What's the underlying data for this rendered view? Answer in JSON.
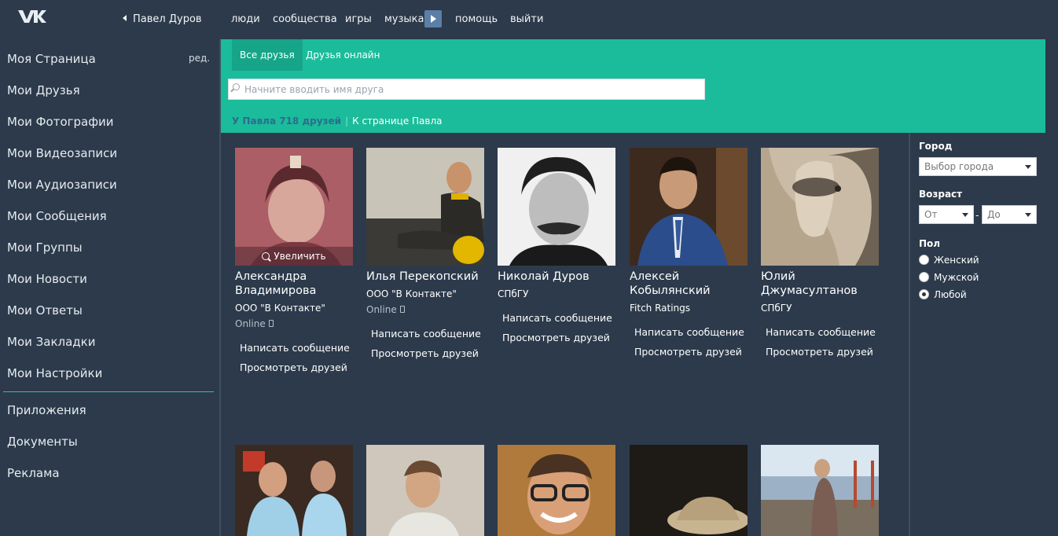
{
  "topbar": {
    "logo": "vk-logo",
    "back_user": "Павел Дуров",
    "nav": [
      "люди",
      "сообщества",
      "игры",
      "музыка",
      "помощь",
      "выйти"
    ]
  },
  "sidebar": {
    "items": [
      {
        "label": "Моя Страница"
      },
      {
        "label": "Мои Друзья"
      },
      {
        "label": "Мои Фотографии"
      },
      {
        "label": "Мои Видеозаписи"
      },
      {
        "label": "Мои Аудиозаписи"
      },
      {
        "label": "Мои Сообщения"
      },
      {
        "label": "Мои Группы"
      },
      {
        "label": "Мои Новости"
      },
      {
        "label": "Мои Ответы"
      },
      {
        "label": "Мои Закладки"
      },
      {
        "label": "Мои Настройки"
      }
    ],
    "edit_label": "ред.",
    "extra": [
      {
        "label": "Приложения"
      },
      {
        "label": "Документы"
      },
      {
        "label": "Реклама"
      }
    ]
  },
  "main": {
    "tabs": [
      {
        "label": "Все друзья",
        "active": true
      },
      {
        "label": "Друзья онлайн",
        "active": false
      }
    ],
    "search_placeholder": "Начните вводить имя друга",
    "friends_count": "У Павла 718 друзей",
    "to_page_link": "К странице Павла"
  },
  "filters": {
    "city_label": "Город",
    "city_select": "Выбор города",
    "age_label": "Возраст",
    "age_from": "От",
    "age_to": "До",
    "age_dash": "-",
    "gender_label": "Пол",
    "gender_options": [
      {
        "label": "Женский",
        "checked": false
      },
      {
        "label": "Мужской",
        "checked": false
      },
      {
        "label": "Любой",
        "checked": true
      }
    ]
  },
  "friends": [
    {
      "name": "Александра Владимирова",
      "work": "ООО \"В Контакте\"",
      "online": "Online",
      "zoom_label": "Увеличить"
    },
    {
      "name": "Илья Перекопский",
      "work": "ООО \"В Контакте\"",
      "online": "Online"
    },
    {
      "name": "Николай Дуров",
      "work": "СПбГУ"
    },
    {
      "name": "Алексей Кобылянский",
      "work": "Fitch Ratings"
    },
    {
      "name": "Юлий Джумасултанов",
      "work": "СПбГУ"
    }
  ],
  "actions": {
    "write_message": "Написать сообщение",
    "view_friends": "Просмотреть друзей"
  },
  "colors": {
    "background": "#2c3a4b",
    "accent": "#1bbc9b",
    "accent_dark": "#16a589",
    "count_text": "#2f6b8e"
  }
}
